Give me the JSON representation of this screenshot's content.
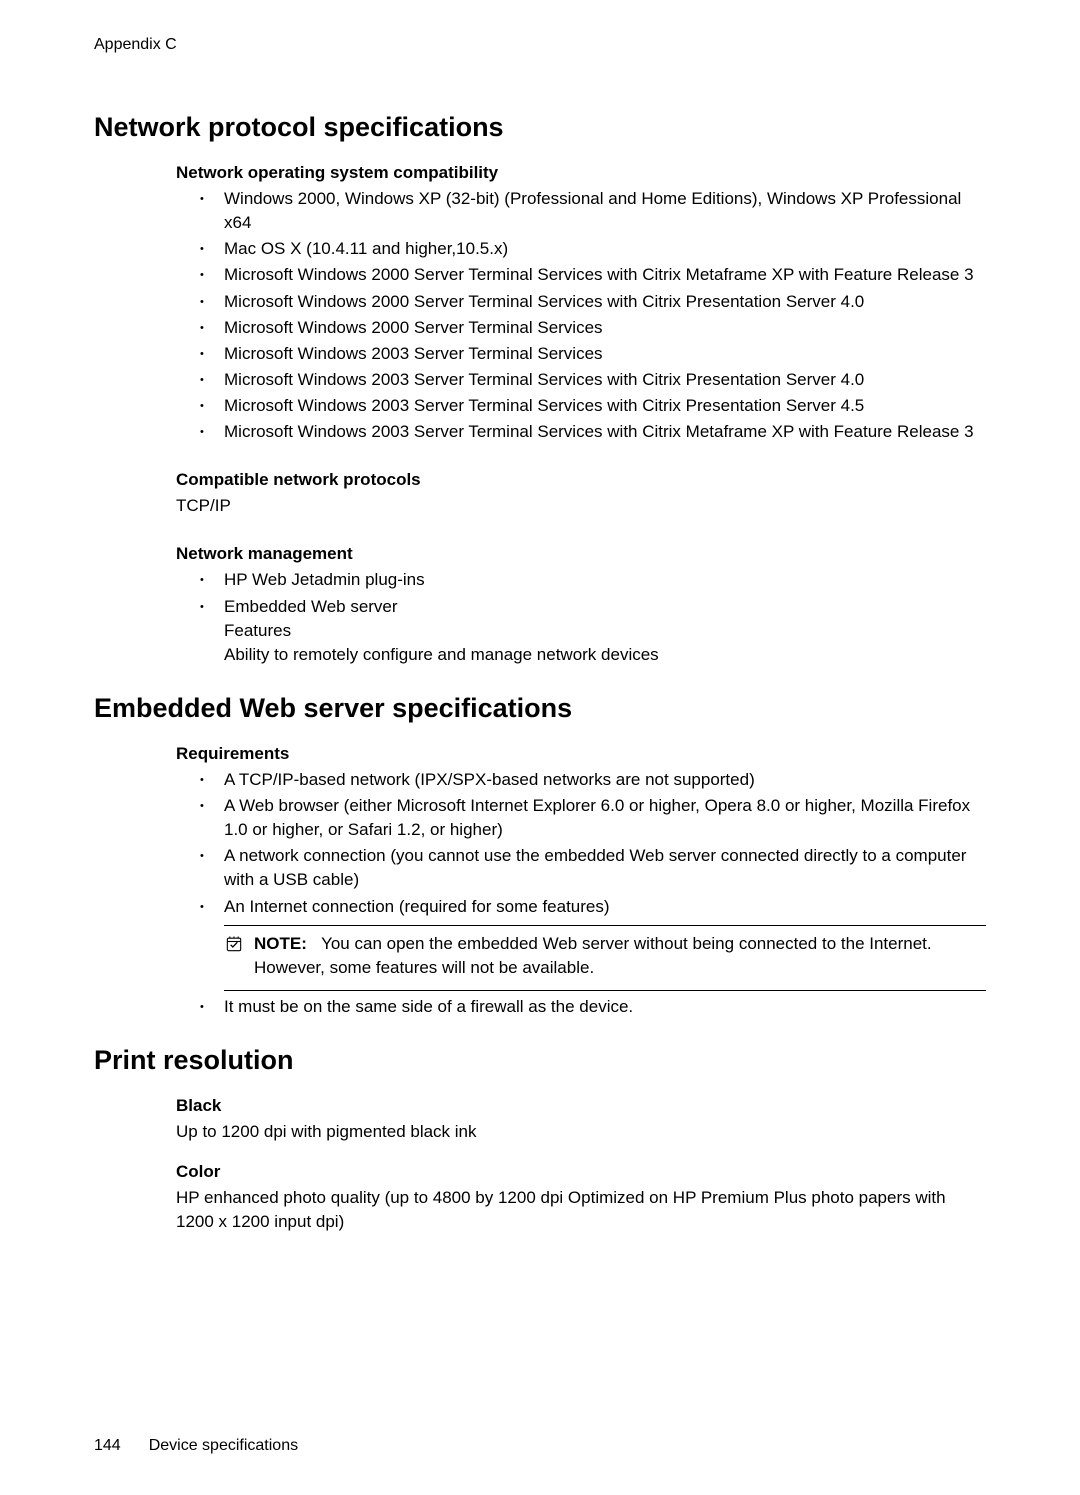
{
  "appendix": "Appendix C",
  "sections": [
    {
      "title": "Network protocol specifications",
      "groups": [
        {
          "heading": "Network operating system compatibility",
          "items": [
            "Windows 2000, Windows XP (32-bit) (Professional and Home Editions), Windows XP Professional x64",
            "Mac OS X (10.4.11 and higher,10.5.x)",
            "Microsoft Windows 2000 Server Terminal Services with Citrix Metaframe XP with Feature Release 3",
            "Microsoft Windows 2000 Server Terminal Services with Citrix Presentation Server 4.0",
            "Microsoft Windows 2000 Server Terminal Services",
            "Microsoft Windows 2003 Server Terminal Services",
            "Microsoft Windows 2003 Server Terminal Services with Citrix Presentation Server 4.0",
            "Microsoft Windows 2003 Server Terminal Services with Citrix Presentation Server 4.5",
            "Microsoft Windows 2003 Server Terminal Services with Citrix Metaframe XP with Feature Release 3"
          ]
        },
        {
          "heading": "Compatible network protocols",
          "body_line": "TCP/IP"
        },
        {
          "heading": "Network management",
          "items_complex": [
            {
              "text": "HP Web Jetadmin plug-ins"
            },
            {
              "text": "Embedded Web server",
              "sub": [
                "Features",
                "Ability to remotely configure and manage network devices"
              ]
            }
          ]
        }
      ]
    },
    {
      "title": "Embedded Web server specifications",
      "groups": [
        {
          "heading": "Requirements",
          "items_pre_note": [
            "A TCP/IP-based network (IPX/SPX-based networks are not supported)",
            "A Web browser (either Microsoft Internet Explorer 6.0 or higher, Opera 8.0 or higher, Mozilla Firefox 1.0 or higher, or Safari 1.2, or higher)",
            "A network connection (you cannot use the embedded Web server connected directly to a computer with a USB cable)",
            "An Internet connection (required for some features)"
          ],
          "note_label": "NOTE:",
          "note_text": "You can open the embedded Web server without being connected to the Internet. However, some features will not be available.",
          "items_post_note": [
            "It must be on the same side of a firewall as the device."
          ]
        }
      ]
    },
    {
      "title": "Print resolution",
      "groups": [
        {
          "heading": "Black",
          "body_line": "Up to 1200 dpi with pigmented black ink"
        },
        {
          "heading": "Color",
          "body_line": "HP enhanced photo quality (up to 4800 by 1200 dpi Optimized on HP Premium Plus photo papers with 1200 x 1200 input dpi)"
        }
      ]
    }
  ],
  "footer": {
    "page_number": "144",
    "section_title": "Device specifications"
  }
}
